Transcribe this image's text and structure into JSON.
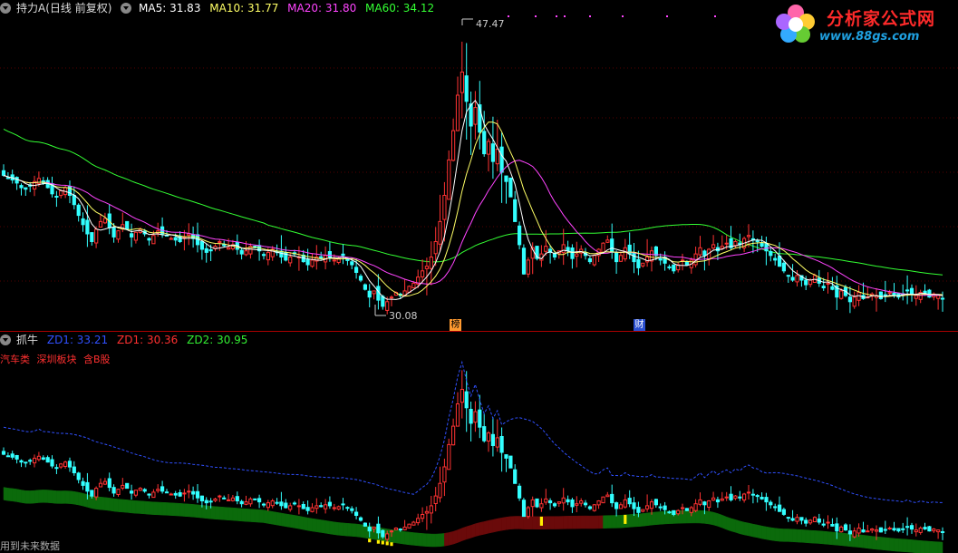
{
  "main_panel": {
    "title": "持力A(日线 前复权)",
    "ma": [
      {
        "label": "MA5: 31.83",
        "color": "#ffffff"
      },
      {
        "label": "MA10: 31.77",
        "color": "#ffff66"
      },
      {
        "label": "MA20: 31.80",
        "color": "#ff44ff"
      },
      {
        "label": "MA60: 34.12",
        "color": "#33ff33"
      }
    ],
    "high_label": "47.47",
    "low_label": "30.08",
    "badge_rank": "榜",
    "badge_fin": "财"
  },
  "sub_panel": {
    "title": "抓牛",
    "indicators": [
      {
        "label": "ZD1: 33.21",
        "color": "#3050ff"
      },
      {
        "label": "ZD1: 30.36",
        "color": "#ff3030"
      },
      {
        "label": "ZD2: 30.95",
        "color": "#33ee33"
      }
    ],
    "concepts": [
      "汽车类",
      "深圳板块",
      "含B股"
    ]
  },
  "footer": "用到未来数据",
  "logo": {
    "title": "分析家公式网",
    "url": "www.88gs.com"
  },
  "colors": {
    "up": "#ff3333",
    "down": "#33ffff",
    "ma5": "#ffffff",
    "ma10": "#ffff66",
    "ma20": "#ff44ff",
    "ma60": "#33ff33"
  },
  "chart_data": {
    "type": "candlestick",
    "price_range": [
      29,
      49
    ],
    "close_series": [
      38.8,
      38.6,
      38.5,
      38.3,
      38.0,
      37.9,
      38.1,
      38.4,
      38.6,
      38.3,
      38.0,
      37.6,
      37.4,
      37.8,
      38.0,
      37.5,
      36.9,
      36.2,
      35.6,
      35.0,
      34.5,
      35.3,
      35.8,
      36.0,
      35.4,
      34.8,
      35.2,
      35.6,
      35.3,
      34.8,
      35.1,
      35.3,
      35.0,
      34.6,
      34.9,
      35.2,
      35.0,
      34.9,
      34.7,
      34.6,
      34.5,
      34.8,
      35.0,
      34.7,
      34.3,
      34.0,
      33.8,
      33.9,
      34.2,
      34.5,
      34.3,
      34.1,
      34.3,
      34.0,
      33.7,
      33.9,
      34.2,
      34.1,
      33.9,
      33.6,
      33.8,
      34.0,
      33.8,
      33.5,
      33.3,
      33.5,
      33.7,
      33.5,
      33.2,
      33.0,
      33.3,
      33.5,
      33.4,
      33.6,
      33.5,
      33.3,
      33.4,
      33.6,
      33.3,
      33.0,
      32.5,
      32.0,
      31.4,
      30.9,
      31.3,
      30.7,
      30.3,
      30.6,
      30.9,
      31.2,
      31.0,
      31.3,
      31.6,
      31.8,
      32.2,
      32.6,
      32.9,
      33.5,
      34.5,
      35.8,
      37.5,
      39.8,
      41.7,
      44.0,
      45.5,
      43.6,
      42.0,
      43.2,
      41.6,
      40.2,
      41.0,
      39.7,
      40.5,
      39.0,
      38.4,
      37.4,
      35.8,
      34.3,
      32.4,
      33.3,
      34.1,
      33.4,
      33.7,
      34.2,
      33.8,
      33.5,
      33.9,
      34.3,
      33.9,
      33.4,
      33.7,
      34.0,
      33.6,
      33.2,
      33.6,
      34.0,
      34.4,
      34.6,
      33.8,
      33.2,
      33.6,
      34.1,
      33.7,
      33.2,
      32.8,
      33.1,
      33.5,
      33.9,
      33.6,
      33.3,
      33.1,
      32.8,
      32.6,
      33.0,
      33.3,
      33.0,
      33.3,
      33.7,
      34.1,
      33.6,
      34.0,
      34.3,
      33.9,
      34.2,
      34.4,
      34.1,
      34.5,
      34.3,
      34.7,
      34.9,
      34.6,
      34.5,
      34.2,
      33.9,
      33.6,
      33.3,
      32.9,
      32.6,
      32.3,
      32.0,
      32.3,
      32.0,
      31.7,
      32.0,
      32.3,
      31.8,
      31.5,
      31.8,
      31.4,
      30.9,
      31.3,
      31.0,
      30.6,
      30.9,
      31.2,
      30.8,
      30.9,
      31.1,
      31.0,
      30.8,
      31.0,
      31.2,
      31.0,
      30.9,
      31.1,
      31.3,
      31.1,
      31.0,
      31.2,
      31.1,
      30.9,
      31.1,
      31.0,
      30.8
    ],
    "low_point": 30.08,
    "high_point": 47.47
  }
}
